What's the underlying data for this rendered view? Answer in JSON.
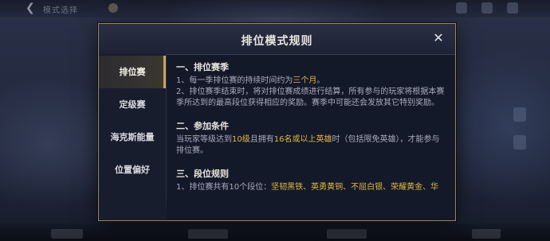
{
  "background": {
    "title": "模式选择"
  },
  "modal": {
    "title": "排位模式规则",
    "close_label": "✕",
    "tabs": [
      {
        "label": "排位赛"
      },
      {
        "label": "定级赛"
      },
      {
        "label": "海克斯能量"
      },
      {
        "label": "位置偏好"
      }
    ],
    "active_tab": "排位赛",
    "sections": [
      {
        "heading": "一、排位赛季",
        "p1_pre": "1、每一季排位赛的持续时间约为",
        "p1_hl": "三个月",
        "p1_post": "。",
        "p2": "2、排位赛季结束时，将对排位赛成绩进行结算，所有参与的玩家将根据本赛季所达到的最高段位获得相应的奖励。赛季中可能还会发放其它特别奖励。"
      },
      {
        "heading": "二、参加条件",
        "t1": "当玩家等级达到",
        "h1": "10级",
        "t2": "且拥有",
        "h2": "16名或以上英雄",
        "t3": "时（包括限免英雄），才能参与排位赛。"
      },
      {
        "heading": "三、段位规则",
        "t1": "1、排位赛共有10个段位：",
        "h1": "坚韧黑铁、英勇黄铜、不屈白银、荣耀黄金、华"
      }
    ]
  },
  "colors": {
    "accent_gold": "#e2b742",
    "border_gold": "#9f8752"
  }
}
